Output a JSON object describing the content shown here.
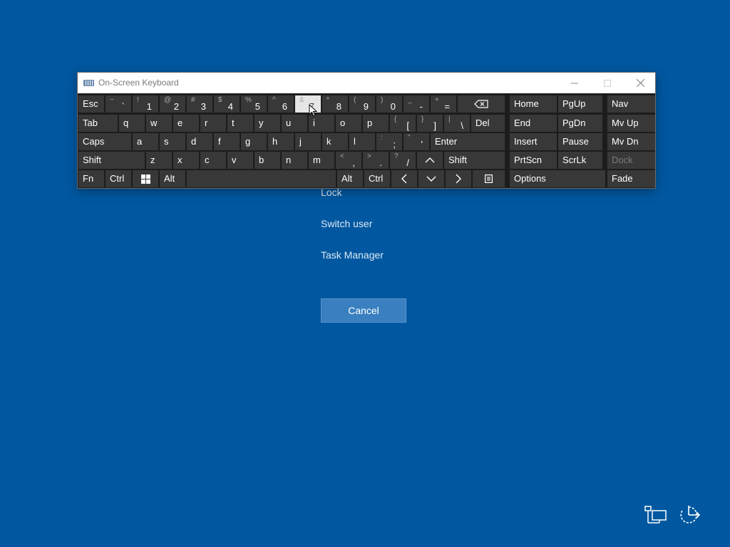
{
  "window": {
    "title": "On-Screen Keyboard",
    "app_icon": "keyboard-icon",
    "controls": [
      "minimize-icon",
      "maximize-icon",
      "close-icon"
    ]
  },
  "keyboard": {
    "rows": [
      [
        {
          "name": "key-esc",
          "label": "Esc"
        },
        {
          "name": "key-backtick",
          "sub": "~",
          "label": "`"
        },
        {
          "name": "key-1",
          "sub": "!",
          "label": "1"
        },
        {
          "name": "key-2",
          "sub": "@",
          "label": "2"
        },
        {
          "name": "key-3",
          "sub": "#",
          "label": "3"
        },
        {
          "name": "key-4",
          "sub": "$",
          "label": "4"
        },
        {
          "name": "key-5",
          "sub": "%",
          "label": "5"
        },
        {
          "name": "key-6",
          "sub": "^",
          "label": "6"
        },
        {
          "name": "key-7",
          "sub": "&",
          "label": "7"
        },
        {
          "name": "key-8",
          "sub": "*",
          "label": "8"
        },
        {
          "name": "key-9",
          "sub": "(",
          "label": "9"
        },
        {
          "name": "key-0",
          "sub": ")",
          "label": "0"
        },
        {
          "name": "key-minus",
          "sub": "_",
          "label": "-"
        },
        {
          "name": "key-equals",
          "sub": "+",
          "label": "="
        },
        {
          "name": "key-backspace",
          "icon": "backspace-icon"
        }
      ],
      [
        {
          "name": "key-tab",
          "label": "Tab"
        },
        {
          "name": "key-q",
          "label": "q"
        },
        {
          "name": "key-w",
          "label": "w"
        },
        {
          "name": "key-e",
          "label": "e"
        },
        {
          "name": "key-r",
          "label": "r"
        },
        {
          "name": "key-t",
          "label": "t"
        },
        {
          "name": "key-y",
          "label": "y"
        },
        {
          "name": "key-u",
          "label": "u"
        },
        {
          "name": "key-i",
          "label": "i"
        },
        {
          "name": "key-o",
          "label": "o"
        },
        {
          "name": "key-p",
          "label": "p"
        },
        {
          "name": "key-open-bracket",
          "sub": "{",
          "label": "["
        },
        {
          "name": "key-close-bracket",
          "sub": "}",
          "label": "]"
        },
        {
          "name": "key-backslash",
          "sub": "|",
          "label": "\\"
        },
        {
          "name": "key-del",
          "label": "Del"
        }
      ],
      [
        {
          "name": "key-caps",
          "label": "Caps"
        },
        {
          "name": "key-a",
          "label": "a"
        },
        {
          "name": "key-s",
          "label": "s"
        },
        {
          "name": "key-d",
          "label": "d"
        },
        {
          "name": "key-f",
          "label": "f"
        },
        {
          "name": "key-g",
          "label": "g"
        },
        {
          "name": "key-h",
          "label": "h"
        },
        {
          "name": "key-j",
          "label": "j"
        },
        {
          "name": "key-k",
          "label": "k"
        },
        {
          "name": "key-l",
          "label": "l"
        },
        {
          "name": "key-semicolon",
          "sub": ":",
          "label": ";"
        },
        {
          "name": "key-quote",
          "sub": "\"",
          "label": "'"
        },
        {
          "name": "key-enter",
          "label": "Enter"
        }
      ],
      [
        {
          "name": "key-shift-left",
          "label": "Shift"
        },
        {
          "name": "key-z",
          "label": "z"
        },
        {
          "name": "key-x",
          "label": "x"
        },
        {
          "name": "key-c",
          "label": "c"
        },
        {
          "name": "key-v",
          "label": "v"
        },
        {
          "name": "key-b",
          "label": "b"
        },
        {
          "name": "key-n",
          "label": "n"
        },
        {
          "name": "key-m",
          "label": "m"
        },
        {
          "name": "key-comma",
          "sub": "<",
          "label": ","
        },
        {
          "name": "key-period",
          "sub": ">",
          "label": "."
        },
        {
          "name": "key-slash",
          "sub": "?",
          "label": "/"
        },
        {
          "name": "key-up",
          "icon": "arrow-up-icon"
        },
        {
          "name": "key-shift-right",
          "label": "Shift"
        }
      ],
      [
        {
          "name": "key-fn",
          "label": "Fn"
        },
        {
          "name": "key-ctrl-left",
          "label": "Ctrl"
        },
        {
          "name": "key-windows",
          "icon": "windows-logo-icon"
        },
        {
          "name": "key-alt-left",
          "label": "Alt"
        },
        {
          "name": "key-space",
          "label": ""
        },
        {
          "name": "key-alt-right",
          "label": "Alt"
        },
        {
          "name": "key-ctrl-right",
          "label": "Ctrl"
        },
        {
          "name": "key-left",
          "icon": "arrow-left-icon"
        },
        {
          "name": "key-down",
          "icon": "arrow-down-icon"
        },
        {
          "name": "key-right",
          "icon": "arrow-right-icon"
        },
        {
          "name": "key-menu",
          "icon": "context-menu-icon"
        }
      ]
    ],
    "nav_keys": [
      [
        {
          "name": "key-home",
          "label": "Home"
        },
        {
          "name": "key-pgup",
          "label": "PgUp"
        },
        {
          "name": "key-nav",
          "label": "Nav"
        }
      ],
      [
        {
          "name": "key-end",
          "label": "End"
        },
        {
          "name": "key-pgdn",
          "label": "PgDn"
        },
        {
          "name": "key-mvup",
          "label": "Mv Up"
        }
      ],
      [
        {
          "name": "key-insert",
          "label": "Insert"
        },
        {
          "name": "key-pause",
          "label": "Pause"
        },
        {
          "name": "key-mvdn",
          "label": "Mv Dn"
        }
      ],
      [
        {
          "name": "key-prtscn",
          "label": "PrtScn"
        },
        {
          "name": "key-scrlk",
          "label": "ScrLk"
        },
        {
          "name": "key-dock",
          "label": "Dock",
          "disabled": true
        }
      ],
      [
        {
          "name": "key-options",
          "label": "Options"
        },
        {
          "name": "key-fade",
          "label": "Fade"
        }
      ]
    ],
    "pressed_key": "key-7"
  },
  "menu": {
    "lock": "Lock",
    "switch_user": "Switch user",
    "task_manager": "Task Manager",
    "cancel": "Cancel"
  },
  "tray": {
    "network_icon": "network-icon",
    "power_icon": "power-ease-of-access-icon"
  },
  "colors": {
    "background": "#0158a0",
    "key": "#383838",
    "key_pressed": "#e6e6e6",
    "keyboard_bg": "#1c1c1c",
    "titlebar": "#ffffff"
  }
}
